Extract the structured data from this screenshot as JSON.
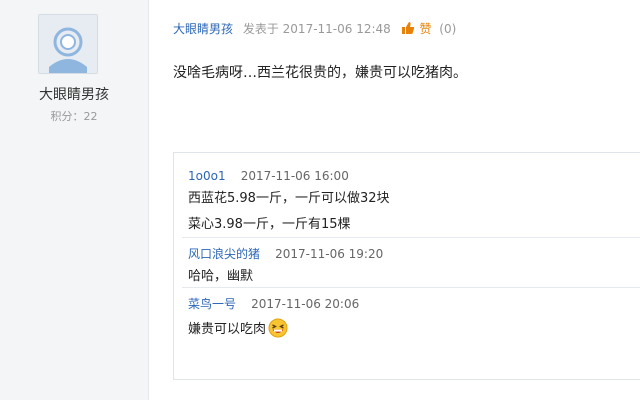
{
  "user_panel": {
    "username": "大眼睛男孩",
    "score": "积分：22"
  },
  "post": {
    "author": "大眼睛男孩",
    "meta": "发表于 2017-11-06 12:48",
    "like_label": "赞",
    "like_count": "(0)",
    "content": "没啥毛病呀…西兰花很贵的，嫌贵可以吃猪肉。"
  },
  "comments": [
    {
      "author": "1o0o1",
      "time": "2017-11-06 16:00",
      "lines": [
        "西蓝花5.98一斤，一斤可以做32块",
        "菜心3.98一斤，一斤有15棵"
      ]
    },
    {
      "author": "风口浪尖的猪",
      "time": "2017-11-06 19:20",
      "lines": [
        "哈哈，幽默"
      ]
    },
    {
      "author": "菜鸟一号",
      "time": "2017-11-06 20:06",
      "lines": [
        "嫌贵可以吃肉"
      ]
    }
  ],
  "colors": {
    "link_blue": "#2b66b6",
    "like_orange": "#e6820a",
    "panel_bg": "#f3f5f7"
  },
  "icons": {
    "avatar": "default-user-avatar-icon",
    "like": "thumbs-up-icon",
    "emoji": "laughing-face-emoji-icon"
  }
}
